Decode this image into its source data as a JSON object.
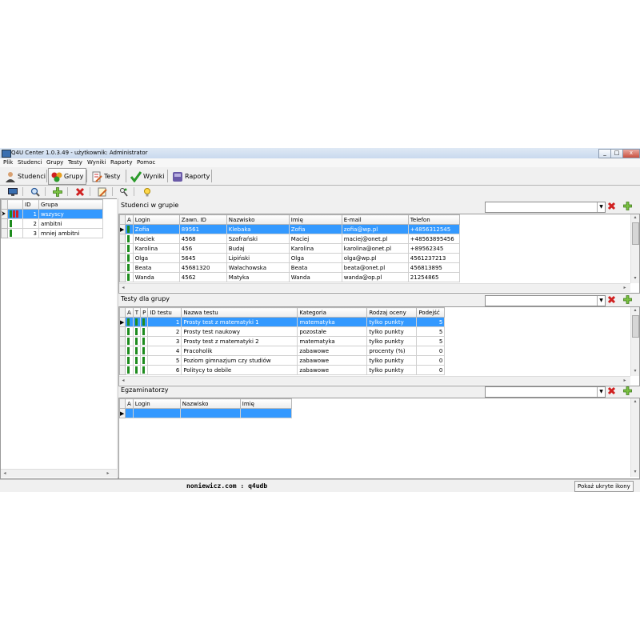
{
  "window": {
    "title": "Q4U Center 1.0.3.49 - użytkownik: Administrator",
    "buttons": [
      "_",
      "□",
      "x"
    ]
  },
  "menu": [
    "Plik",
    "Studenci",
    "Grupy",
    "Testy",
    "Wyniki",
    "Raporty",
    "Pomoc"
  ],
  "tabs": [
    {
      "label": "Studenci",
      "icon": "user-icon"
    },
    {
      "label": "Grupy",
      "icon": "groups-icon"
    },
    {
      "label": "Testy",
      "icon": "test-sheet-icon"
    },
    {
      "label": "Wyniki",
      "icon": "checkmark-icon"
    },
    {
      "label": "Raporty",
      "icon": "report-icon"
    }
  ],
  "toolbar_icons": [
    "monitor-icon",
    "search-icon",
    "add-icon",
    "delete-icon",
    "edit-icon",
    "filter-icon",
    "bulb-icon"
  ],
  "groups": {
    "columns": [
      "ID",
      "Grupa"
    ],
    "rows": [
      {
        "id": "1",
        "name": "wszyscy",
        "flags": [
          "green",
          "red",
          "red"
        ],
        "selected": true
      },
      {
        "id": "2",
        "name": "ambitni",
        "flags": [
          "green"
        ],
        "selected": false
      },
      {
        "id": "3",
        "name": "mniej ambitni",
        "flags": [
          "green"
        ],
        "selected": false
      }
    ]
  },
  "students": {
    "title": "Studenci w grupie",
    "columns": [
      "A",
      "Login",
      "Zawn. ID",
      "Nazwisko",
      "Imię",
      "E-mail",
      "Telefon"
    ],
    "rows": [
      [
        "Zofia",
        "89561",
        "Klebaka",
        "Zofia",
        "zofia@wp.pl",
        "+4856312545"
      ],
      [
        "Maciek",
        "4568",
        "Szafrański",
        "Maciej",
        "maciej@onet.pl",
        "+48563895456"
      ],
      [
        "Karolina",
        "456",
        "Budaj",
        "Karolina",
        "karolina@onet.pl",
        "+89562345"
      ],
      [
        "Olga",
        "5645",
        "Lipiński",
        "Olga",
        "olga@wp.pl",
        "4561237213"
      ],
      [
        "Beata",
        "45681320",
        "Wałachowska",
        "Beata",
        "beata@onet.pl",
        "456813895"
      ],
      [
        "Wanda",
        "4562",
        "Matyka",
        "Wanda",
        "wanda@op.pl",
        "21254865"
      ]
    ]
  },
  "tests": {
    "title": "Testy dla grupy",
    "columns": [
      "A",
      "T",
      "P",
      "ID testu",
      "Nazwa testu",
      "Kategoria",
      "Rodzaj oceny",
      "Podejść"
    ],
    "rows": [
      [
        "1",
        "Prosty test z matematyki 1",
        "matematyka",
        "tylko punkty",
        "5"
      ],
      [
        "2",
        "Prosty test naukowy",
        "pozostałe",
        "tylko punkty",
        "5"
      ],
      [
        "3",
        "Prosty test z matematyki 2",
        "matematyka",
        "tylko punkty",
        "5"
      ],
      [
        "4",
        "Pracoholik",
        "zabawowe",
        "procenty (%)",
        "0"
      ],
      [
        "5",
        "Poziom gimnazjum czy studiów",
        "zabawowe",
        "tylko punkty",
        "0"
      ],
      [
        "6",
        "Politycy to debile",
        "zabawowe",
        "tylko punkty",
        "0"
      ]
    ]
  },
  "examiners": {
    "title": "Egzaminatorzy",
    "columns": [
      "A",
      "Login",
      "Nazwisko",
      "Imię"
    ]
  },
  "status": {
    "center": "noniewicz.com : q4udb",
    "button": "Pokaż ukryte ikony"
  },
  "colors": {
    "selection": "#3399ff",
    "flag_green": "#1e8c1e",
    "flag_red": "#d0202a"
  }
}
